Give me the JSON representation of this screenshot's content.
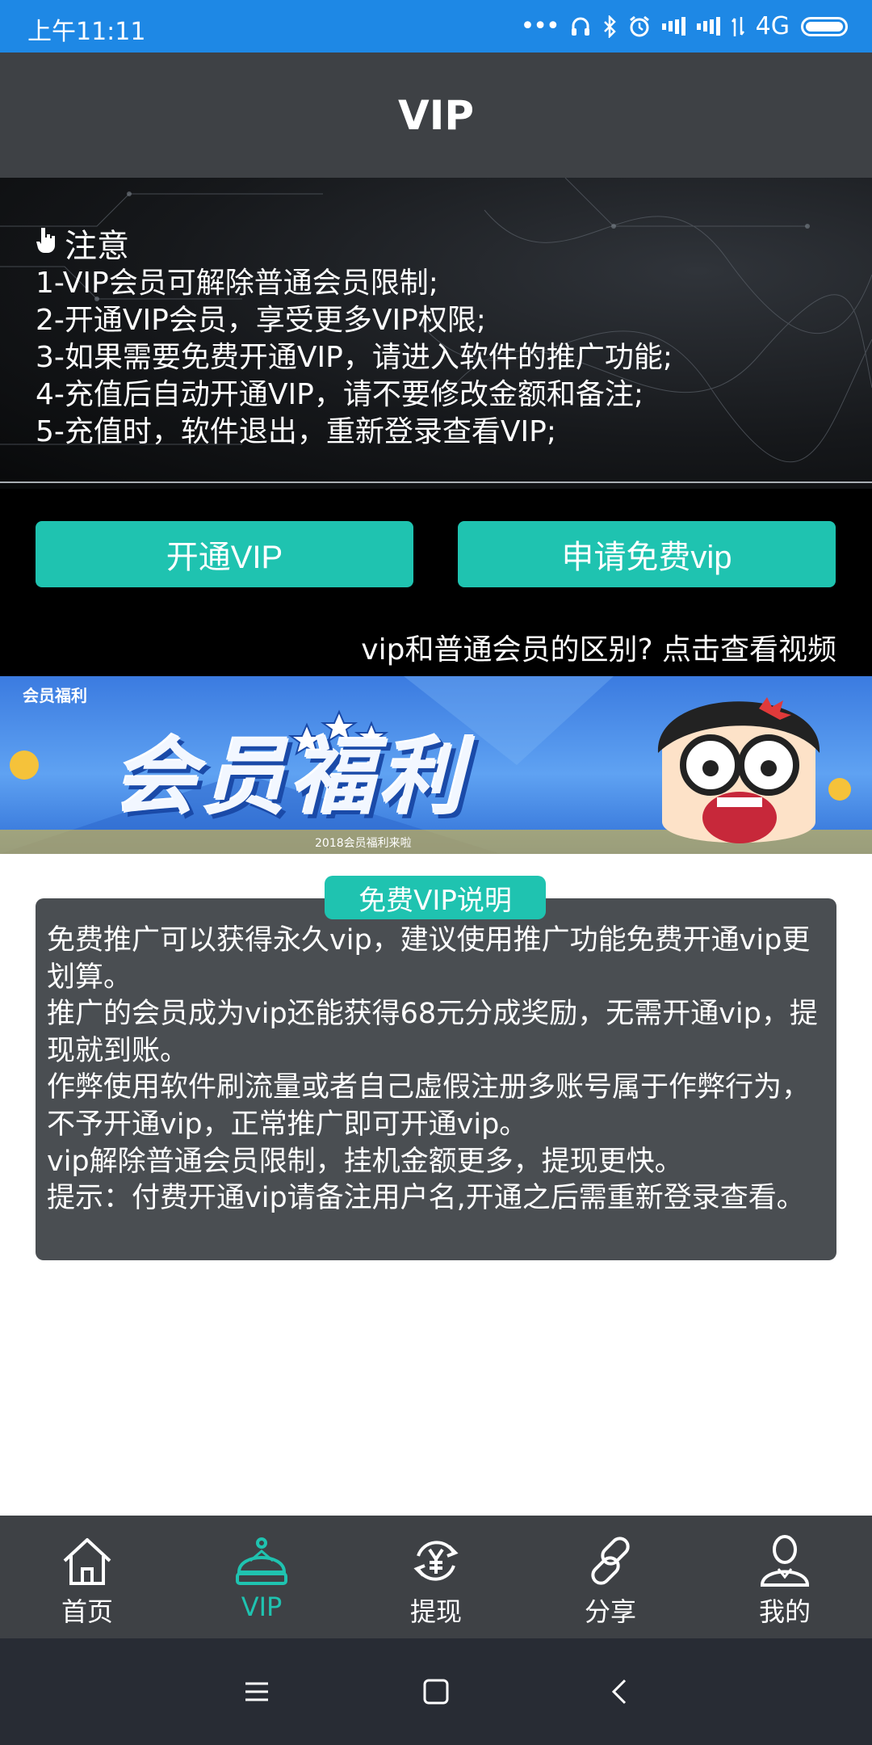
{
  "status_bar": {
    "time": "上午11:11",
    "network": "4G"
  },
  "header": {
    "title": "VIP"
  },
  "notice": {
    "heading": "注意",
    "lines": [
      "1-VIP会员可解除普通会员限制;",
      "2-开通VIP会员，享受更多VIP权限;",
      "3-如果需要免费开通VIP，请进入软件的推广功能;",
      "4-充值后自动开通VIP，请不要修改金额和备注;",
      "5-充值时，软件退出，重新登录查看VIP;"
    ]
  },
  "actions": {
    "open_vip": "开通VIP",
    "apply_free_vip": "申请免费vip",
    "difference_link": "vip和普通会员的区别? 点击查看视频"
  },
  "banner": {
    "tag": "会员福利",
    "title": "会员福利",
    "subtitle": "2018会员福利来啦"
  },
  "explanation": {
    "title": "免费VIP说明",
    "paragraphs": [
      "免费推广可以获得永久vip，建议使用推广功能免费开通vip更划算。",
      "推广的会员成为vip还能获得68元分成奖励，无需开通vip，提现就到账。",
      "作弊使用软件刷流量或者自己虚假注册多账号属于作弊行为，不予开通vip，正常推广即可开通vip。",
      "vip解除普通会员限制，挂机金额更多，提现更快。",
      "提示：付费开通vip请备注用户名,开通之后需重新登录查看。"
    ]
  },
  "tabbar": {
    "items": [
      {
        "label": "首页",
        "icon": "home-icon"
      },
      {
        "label": "VIP",
        "icon": "crown-icon",
        "active": true
      },
      {
        "label": "提现",
        "icon": "yuan-refresh-icon"
      },
      {
        "label": "分享",
        "icon": "link-icon"
      },
      {
        "label": "我的",
        "icon": "user-icon"
      }
    ]
  },
  "colors": {
    "accent": "#1fc3b0",
    "status_bar": "#1e88e5",
    "header": "#3e4145",
    "panel": "#4a4e52"
  }
}
